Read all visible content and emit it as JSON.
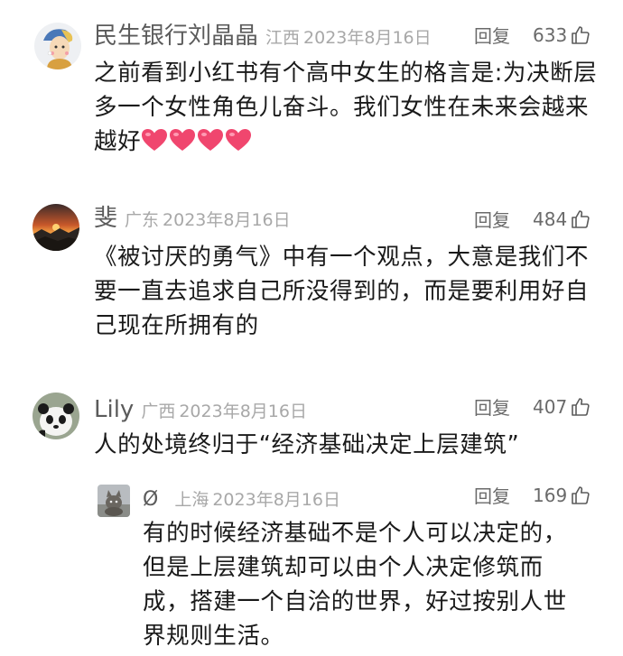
{
  "comments": [
    {
      "username": "民生银行刘晶晶",
      "location": "江西",
      "date": "2023年8月16日",
      "reply_label": "回复",
      "likes": "633",
      "text": "之前看到小红书有个高中女生的格言是:为决断层多一个女性角色儿奋斗。我们女性在未来会越来越好",
      "emoji": [
        "heart-emoji",
        "heart-emoji",
        "heart-emoji",
        "heart-emoji"
      ]
    },
    {
      "username": "斐",
      "location": "广东",
      "date": "2023年8月16日",
      "reply_label": "回复",
      "likes": "484",
      "text": "《被讨厌的勇气》中有一个观点，大意是我们不要一直去追求自己所没得到的，而是要利用好自己现在所拥有的"
    },
    {
      "username": "Lily",
      "location": "广西",
      "date": "2023年8月16日",
      "reply_label": "回复",
      "likes": "407",
      "text": "人的处境终归于“经济基础决定上层建筑”"
    }
  ],
  "reply": {
    "username": "Ø",
    "location": "上海",
    "date": "2023年8月16日",
    "reply_label": "回复",
    "likes": "169",
    "text": "有的时候经济基础不是个人可以决定的，但是上层建筑却可以由个人决定修筑而成，搭建一个自洽的世界，好过按别人世界规则生活。"
  },
  "icons": {
    "like": "thumbs-up-outline-icon"
  },
  "colors": {
    "username": "#5b5b5b",
    "meta": "#a8a8a8",
    "text": "#1a1a1a",
    "heart": "#f0466e"
  }
}
